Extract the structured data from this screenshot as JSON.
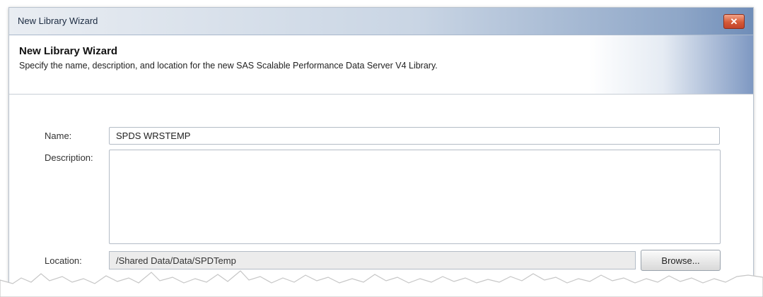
{
  "window": {
    "title": "New Library Wizard",
    "close_glyph": "✕"
  },
  "header": {
    "title": "New Library Wizard",
    "subtitle": "Specify the name, description, and location for the new SAS Scalable Performance Data Server V4 Library."
  },
  "form": {
    "name_label": "Name:",
    "name_value": "SPDS WRSTEMP",
    "description_label": "Description:",
    "description_value": "",
    "location_label": "Location:",
    "location_value": "/Shared Data/Data/SPDTemp",
    "browse_label": "Browse..."
  },
  "colors": {
    "titlebar_accent": "#6f8db8",
    "close_button": "#d55a37"
  }
}
